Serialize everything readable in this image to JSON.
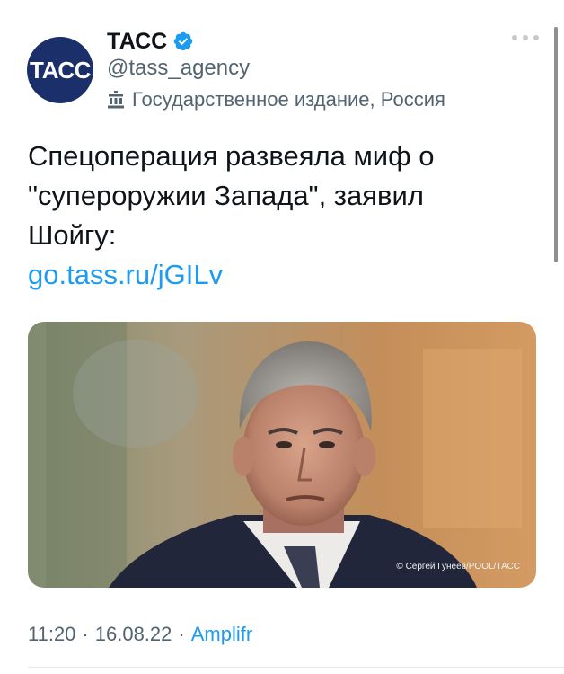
{
  "account": {
    "avatar_text": "ТАСС",
    "display_name": "ТАСС",
    "handle": "@tass_agency",
    "label": "Государственное издание, Россия",
    "verified_icon": "verified-badge-icon",
    "label_icon": "state-media-icon",
    "avatar_color": "#1b2f6b"
  },
  "tweet": {
    "lines": [
      "Спецоперация развеяла миф о",
      "\"супероружии Запада\", заявил",
      "Шойгу:"
    ],
    "link": "go.tass.ru/jGILv",
    "photo_credit": "© Сергей Гунеев/POOL/ТАСС"
  },
  "meta": {
    "time": "11:20",
    "separator": "·",
    "date": "16.08.22",
    "source": "Amplifr"
  },
  "colors": {
    "accent": "#1d9bf0",
    "secondary_text": "#536471"
  }
}
